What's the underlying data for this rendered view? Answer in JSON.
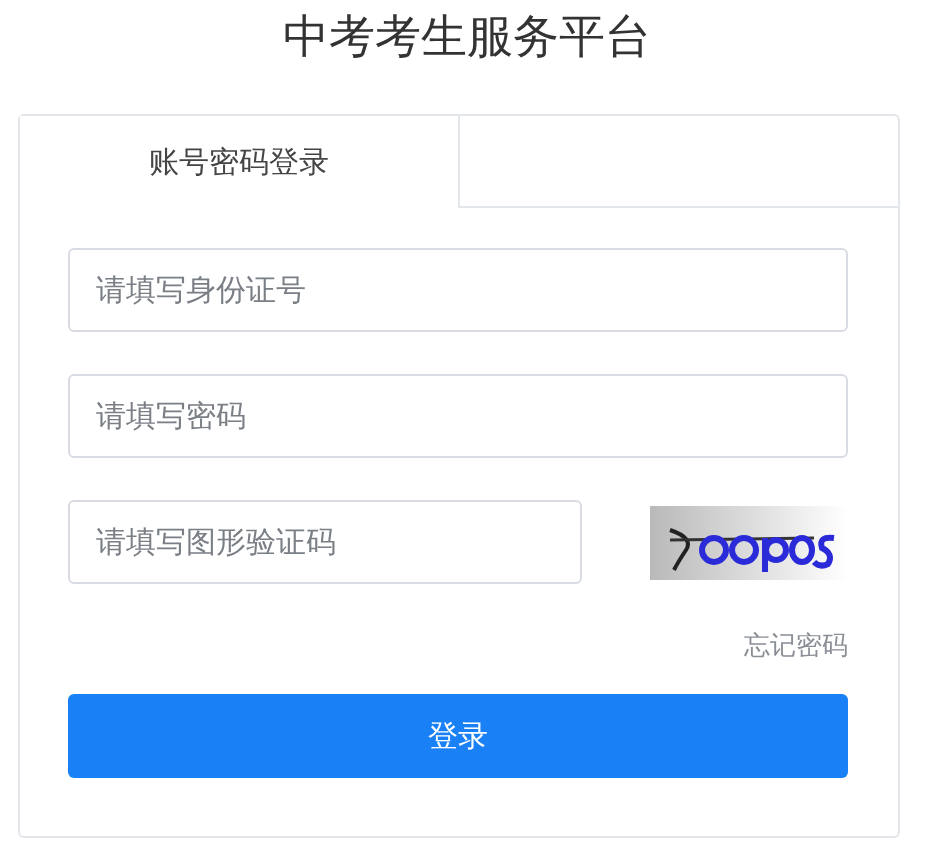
{
  "title": "中考考生服务平台",
  "tabs": [
    {
      "label": "账号密码登录",
      "selected": true
    }
  ],
  "fields": [
    {
      "placeholder": "请填写身份证号"
    },
    {
      "placeholder": "请填写密码"
    },
    {
      "placeholder": "请填写图形验证码"
    }
  ],
  "forgot_link": "忘记密码",
  "submit_button": "登录"
}
